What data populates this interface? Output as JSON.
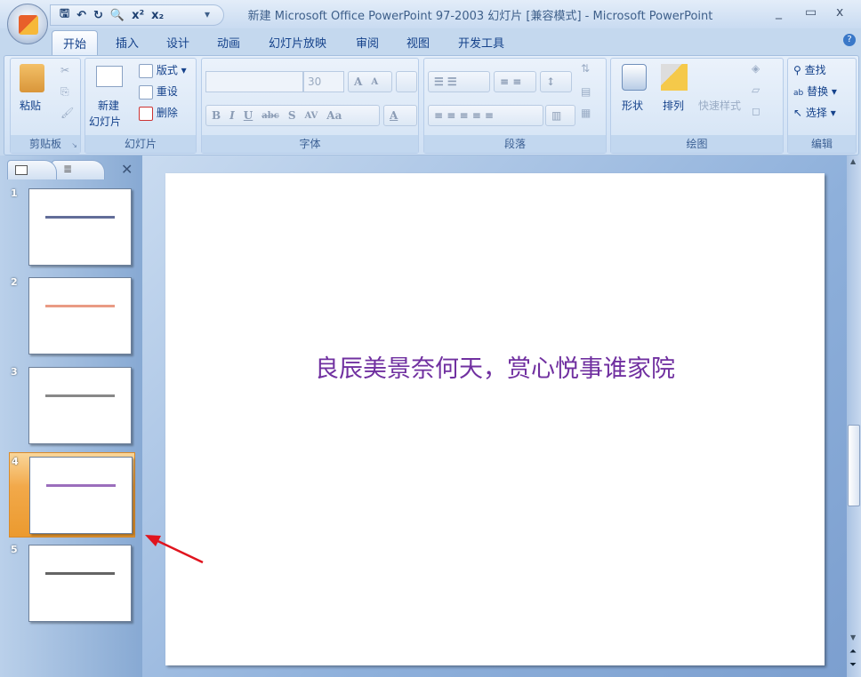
{
  "window": {
    "title": "新建 Microsoft Office PowerPoint 97-2003 幻灯片 [兼容模式] - Microsoft PowerPoint",
    "minimize": "_",
    "maximize": "▭",
    "close": "x"
  },
  "qat": {
    "save": "🖫",
    "undo": "↶",
    "redo": "↻",
    "preview": "🔍",
    "superscript": "x²",
    "subscript": "x₂",
    "customize": "▾"
  },
  "tabs": [
    "开始",
    "插入",
    "设计",
    "动画",
    "幻灯片放映",
    "审阅",
    "视图",
    "开发工具"
  ],
  "active_tab": "开始",
  "help": "?",
  "ribbon": {
    "clipboard": {
      "label": "剪贴板",
      "paste": "粘贴"
    },
    "slides": {
      "label": "幻灯片",
      "new_slide_line1": "新建",
      "new_slide_line2": "幻灯片",
      "layout": "版式",
      "reset": "重设",
      "delete": "删除"
    },
    "font": {
      "label": "字体",
      "font_name": "",
      "font_size": "30",
      "bold": "B",
      "italic": "I",
      "underline": "U",
      "strike": "abc",
      "shadow": "S",
      "spacing": "AV",
      "case": "Aa",
      "color": "A"
    },
    "paragraph": {
      "label": "段落"
    },
    "drawing": {
      "label": "绘图",
      "shapes": "形状",
      "arrange": "排列",
      "quick_styles": "快速样式"
    },
    "editing": {
      "label": "编辑",
      "find": "查找",
      "replace": "替换",
      "select": "选择"
    }
  },
  "slides_panel": {
    "close": "✕",
    "slides": [
      {
        "number": "1",
        "color": "#1f2f6e"
      },
      {
        "number": "2",
        "color": "#e07050"
      },
      {
        "number": "3",
        "color": "#555555"
      },
      {
        "number": "4",
        "color": "#7030a0",
        "selected": true
      },
      {
        "number": "5",
        "color": "#222222"
      }
    ]
  },
  "current_slide": {
    "text": "良辰美景奈何天，赏心悦事谁家院",
    "color": "#7030a0"
  },
  "annotation": {
    "arrow_color": "#e0141e"
  }
}
